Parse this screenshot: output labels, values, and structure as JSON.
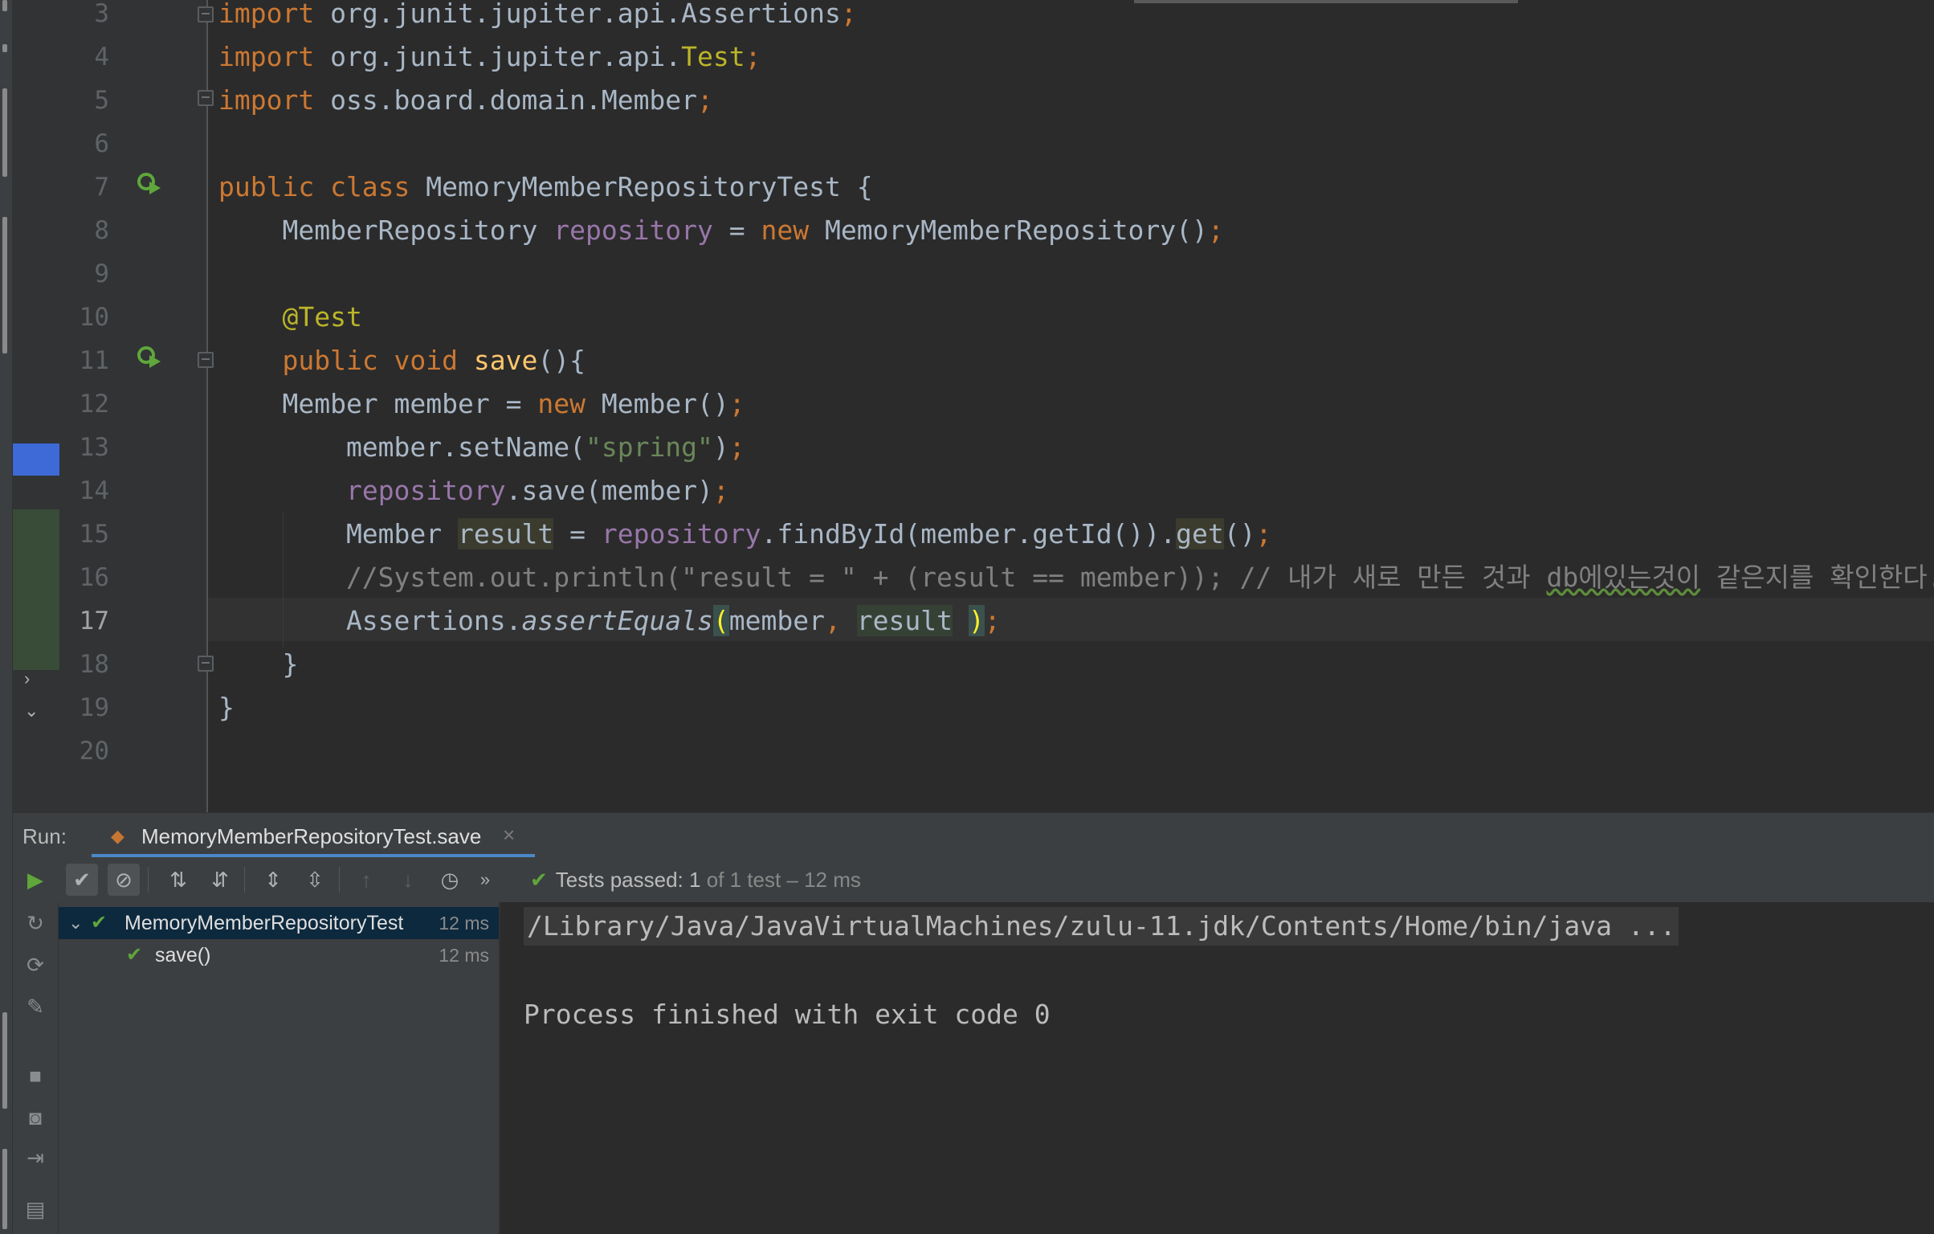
{
  "editor": {
    "lines": [
      {
        "num": "3",
        "segments": [
          {
            "t": "import ",
            "c": "kw"
          },
          {
            "t": "org.junit.jupiter.api.Assertions",
            "c": "cls"
          },
          {
            "t": ";",
            "c": "kw"
          }
        ]
      },
      {
        "num": "4",
        "segments": [
          {
            "t": "import ",
            "c": "kw"
          },
          {
            "t": "org.junit.jupiter.api.",
            "c": "cls"
          },
          {
            "t": "Test",
            "c": "anno"
          },
          {
            "t": ";",
            "c": "kw"
          }
        ]
      },
      {
        "num": "5",
        "segments": [
          {
            "t": "import ",
            "c": "kw"
          },
          {
            "t": "oss.board.domain.Member",
            "c": "cls"
          },
          {
            "t": ";",
            "c": "kw"
          }
        ]
      },
      {
        "num": "6",
        "segments": []
      },
      {
        "num": "7",
        "segments": [
          {
            "t": "public class ",
            "c": "kw"
          },
          {
            "t": "MemoryMemberRepositoryTest {",
            "c": "cls"
          }
        ]
      },
      {
        "num": "8",
        "segments": [
          {
            "t": "    MemberRepository ",
            "c": "cls"
          },
          {
            "t": "repository",
            "c": "field"
          },
          {
            "t": " = ",
            "c": "cls"
          },
          {
            "t": "new ",
            "c": "kw"
          },
          {
            "t": "MemoryMemberRepository()",
            "c": "cls"
          },
          {
            "t": ";",
            "c": "kw"
          }
        ]
      },
      {
        "num": "9",
        "segments": []
      },
      {
        "num": "10",
        "segments": [
          {
            "t": "    ",
            "c": "cls"
          },
          {
            "t": "@Test",
            "c": "anno"
          }
        ]
      },
      {
        "num": "11",
        "segments": [
          {
            "t": "    ",
            "c": "cls"
          },
          {
            "t": "public void ",
            "c": "kw"
          },
          {
            "t": "save",
            "c": "method"
          },
          {
            "t": "(){",
            "c": "cls"
          }
        ]
      },
      {
        "num": "12",
        "segments": [
          {
            "t": "    Member member = ",
            "c": "cls"
          },
          {
            "t": "new ",
            "c": "kw"
          },
          {
            "t": "Member()",
            "c": "cls"
          },
          {
            "t": ";",
            "c": "kw"
          }
        ]
      },
      {
        "num": "13",
        "segments": [
          {
            "t": "        member.setName(",
            "c": "cls"
          },
          {
            "t": "\"spring\"",
            "c": "str"
          },
          {
            "t": ")",
            "c": "cls"
          },
          {
            "t": ";",
            "c": "kw"
          }
        ]
      },
      {
        "num": "14",
        "segments": [
          {
            "t": "        ",
            "c": "cls"
          },
          {
            "t": "repository",
            "c": "field"
          },
          {
            "t": ".save(member)",
            "c": "cls"
          },
          {
            "t": ";",
            "c": "kw"
          }
        ]
      },
      {
        "num": "15",
        "segments": [
          {
            "t": "        Member ",
            "c": "cls"
          },
          {
            "t": "result",
            "c": "cls hl-warn"
          },
          {
            "t": " = ",
            "c": "cls"
          },
          {
            "t": "repository",
            "c": "field"
          },
          {
            "t": ".findById(member.getId()).",
            "c": "cls"
          },
          {
            "t": "get",
            "c": "cls hl-warn"
          },
          {
            "t": "()",
            "c": "cls"
          },
          {
            "t": ";",
            "c": "kw"
          }
        ]
      },
      {
        "num": "16",
        "segments": [
          {
            "t": "        //System.out.println(\"result = \" + (result == member)); // 내가 새로 만든 것과 ",
            "c": "cmt"
          },
          {
            "t": "db에있는것이",
            "c": "cmt typo"
          },
          {
            "t": " 같은지를 확인한다.",
            "c": "cmt"
          }
        ]
      },
      {
        "num": "17",
        "segments": [
          {
            "t": "        Assertions.",
            "c": "cls"
          },
          {
            "t": "assertEquals",
            "c": "cls italic"
          },
          {
            "t": "(",
            "c": "brace-match"
          },
          {
            "t": "member",
            "c": "cls"
          },
          {
            "t": ", ",
            "c": "kw"
          },
          {
            "t": "result",
            "c": "cls hl-var"
          },
          {
            "t": " ",
            "c": "cls"
          },
          {
            "t": ")",
            "c": "brace-match"
          },
          {
            "t": ";",
            "c": "kw"
          }
        ]
      },
      {
        "num": "18",
        "segments": [
          {
            "t": "    }",
            "c": "cls"
          }
        ]
      },
      {
        "num": "19",
        "segments": [
          {
            "t": "}",
            "c": "cls"
          }
        ]
      },
      {
        "num": "20",
        "segments": []
      }
    ],
    "current_line": "17"
  },
  "run": {
    "label": "Run:",
    "tab_label": "MemoryMemberRepositoryTest.save",
    "tab_close": "×",
    "status_main": "Tests passed: ",
    "status_count": "1",
    "status_rest": " of 1 test – 12 ms"
  },
  "test_tree": {
    "root": {
      "label": "MemoryMemberRepositoryTest",
      "time": "12 ms"
    },
    "child": {
      "label": "save()",
      "time": "12 ms"
    }
  },
  "console": {
    "command": "/Library/Java/JavaVirtualMachines/zulu-11.jdk/Contents/Home/bin/java ...",
    "exit_message": "Process finished with exit code 0"
  },
  "colors": {
    "keyword": "#cc7832",
    "field": "#9876aa",
    "annotation": "#bbb529",
    "method": "#ffc66d",
    "string": "#6a8759",
    "comment": "#808080",
    "pass_green": "#5fa63b",
    "selection_blue": "#0d293e"
  }
}
